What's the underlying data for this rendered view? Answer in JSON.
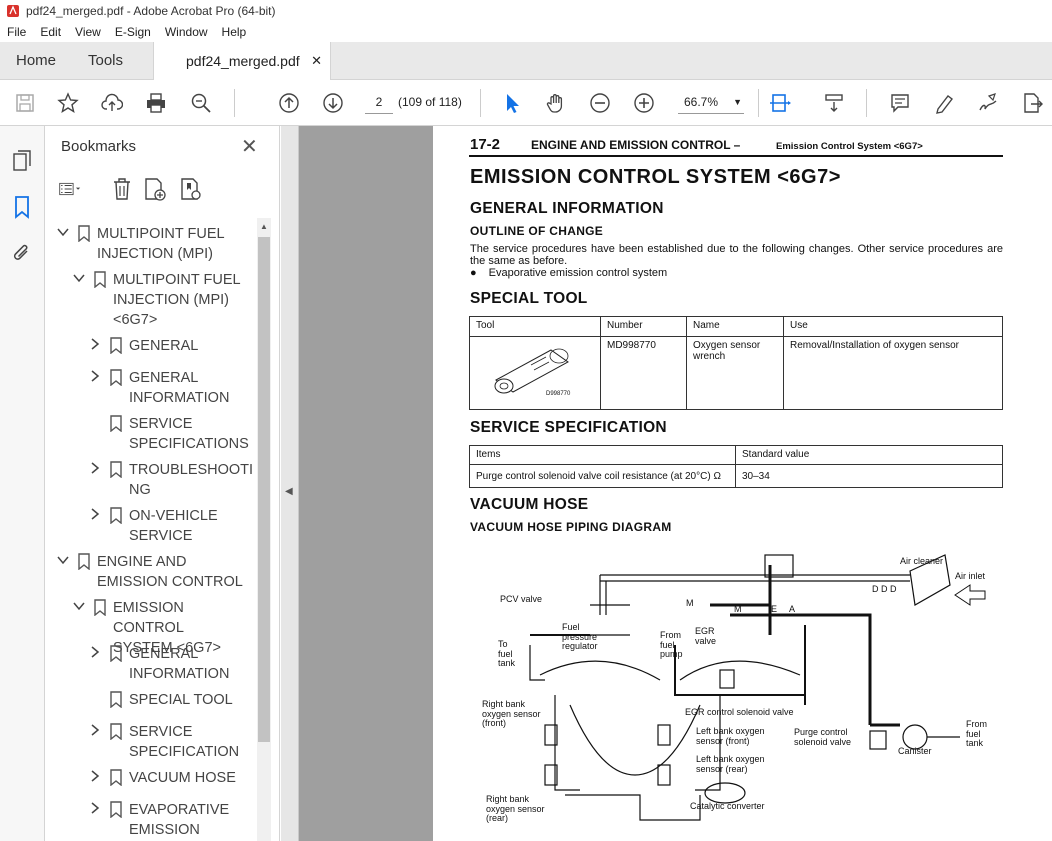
{
  "window": {
    "title": "pdf24_merged.pdf - Adobe Acrobat Pro (64-bit)"
  },
  "menu": [
    "File",
    "Edit",
    "View",
    "E-Sign",
    "Window",
    "Help"
  ],
  "tabs": {
    "home": "Home",
    "tools": "Tools",
    "doc": "pdf24_merged.pdf",
    "doc_close": "✕"
  },
  "toolbar": {
    "page_current": "2",
    "page_count": "(109 of 118)",
    "zoom": "66.7%"
  },
  "bookmarks": {
    "title": "Bookmarks",
    "close": "✕",
    "items": [
      {
        "label": "MULTIPOINT FUEL\nINJECTION (MPI)",
        "level": 0,
        "expander": "expanded"
      },
      {
        "label": "MULTIPOINT FUEL\nINJECTION (MPI)\n<6G7>",
        "level": 1,
        "expander": "expanded"
      },
      {
        "label": "GENERAL",
        "level": 2,
        "expander": "collapsed"
      },
      {
        "label": "GENERAL\nINFORMATION",
        "level": 2,
        "expander": "collapsed"
      },
      {
        "label": "SERVICE\nSPECIFICATIONS",
        "level": 2,
        "expander": "none"
      },
      {
        "label": "TROUBLESHOOTI\nNG",
        "level": 2,
        "expander": "collapsed"
      },
      {
        "label": "ON-VEHICLE\nSERVICE",
        "level": 2,
        "expander": "collapsed"
      },
      {
        "label": "ENGINE AND\nEMISSION CONTROL",
        "level": 0,
        "expander": "expanded"
      },
      {
        "label": "EMISSION CONTROL\nSYSTEM <6G7>",
        "level": 1,
        "expander": "expanded"
      },
      {
        "label": "GENERAL\nINFORMATION",
        "level": 2,
        "expander": "collapsed"
      },
      {
        "label": "SPECIAL TOOL",
        "level": 2,
        "expander": "none"
      },
      {
        "label": "SERVICE\nSPECIFICATION",
        "level": 2,
        "expander": "collapsed"
      },
      {
        "label": "VACUUM HOSE",
        "level": 2,
        "expander": "collapsed"
      },
      {
        "label": "EVAPORATIVE\nEMISSION",
        "level": 2,
        "expander": "collapsed"
      }
    ]
  },
  "document": {
    "header_num": "17-2",
    "header_text": "ENGINE AND EMISSION CONTROL –",
    "header_sub": "Emission Control System <6G7>",
    "title": "EMISSION CONTROL SYSTEM <6G7>",
    "general_info": "GENERAL INFORMATION",
    "outline": "OUTLINE OF CHANGE",
    "outline_body": "The service procedures have been established due to the following changes. Other service procedures are the same as before.",
    "bullet": "Evaporative emission control system",
    "special_tool": "SPECIAL TOOL",
    "tool_table": {
      "headers": [
        "Tool",
        "Number",
        "Name",
        "Use"
      ],
      "number": "MD998770",
      "name": "Oxygen sensor wrench",
      "use": "Removal/Installation of oxygen sensor",
      "tool_caption": "D998770"
    },
    "service_spec": "SERVICE SPECIFICATION",
    "spec_table": {
      "headers": [
        "Items",
        "Standard value"
      ],
      "item": "Purge control solenoid valve coil resistance (at 20°C)  Ω",
      "value": "30–34"
    },
    "vacuum_hose": "VACUUM HOSE",
    "piping": "VACUUM HOSE PIPING DIAGRAM",
    "diagram_labels": {
      "air_cleaner": "Air cleaner",
      "air_inlet": "Air inlet",
      "pcv": "PCV valve",
      "fuel_reg": "Fuel\npressure\nregulator",
      "to_tank": "To\nfuel\ntank",
      "from_pump": "From\nfuel\npump",
      "egr_valve": "EGR\nvalve",
      "egr_sol": "EGR control solenoid valve",
      "rb_front": "Right bank\noxygen sensor\n(front)",
      "lb_front": "Left bank oxygen\nsensor (front)",
      "lb_rear": "Left bank oxygen\nsensor (rear)",
      "purge": "Purge control\nsolenoid valve",
      "canister": "Canister",
      "from_tank": "From\nfuel\ntank",
      "rb_rear": "Right bank\noxygen sensor\n(rear)",
      "catalytic": "Catalytic converter",
      "m1": "M",
      "m2": "M",
      "e": "E",
      "a": "A",
      "ddd": "D D D"
    }
  },
  "colors": {
    "accent_blue": "#1473e6",
    "viewer_bg": "#9f9f9f"
  }
}
